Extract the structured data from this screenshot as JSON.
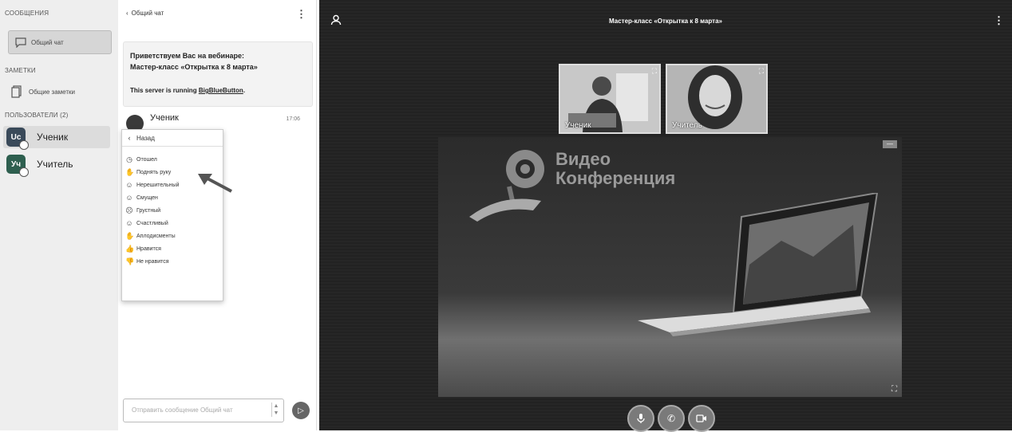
{
  "sidebar": {
    "messages_header": "СООБЩЕНИЯ",
    "chat_item": "Общий чат",
    "notes_header": "ЗАМЕТКИ",
    "notes_item": "Общие заметки",
    "users_header": "ПОЛЬЗОВАТЕЛИ (2)",
    "users": [
      {
        "initials": "Uc",
        "name": "Ученик",
        "color": "#3a4a5a"
      },
      {
        "initials": "Уч",
        "name": "Учитель",
        "color": "#2e5f4f"
      }
    ]
  },
  "chat": {
    "back_label": "Общий чат",
    "welcome_line1": "Приветствуем Вас на вебинаре:",
    "welcome_line2": "Мастер-класс «Открытка к 8 марта»",
    "server_prefix": "This server is running ",
    "server_link": "BigBlueButton",
    "server_suffix": ".",
    "message_author": "Ученик",
    "message_time": "17:06",
    "input_placeholder": "Отправить сообщение Общий чат"
  },
  "status_menu": {
    "back_label": "Назад",
    "items": [
      {
        "icon": "clock-icon",
        "glyph": "◷",
        "label": "Отошел"
      },
      {
        "icon": "hand-icon",
        "glyph": "✋",
        "label": "Поднять руку"
      },
      {
        "icon": "undecided-icon",
        "glyph": "☺",
        "label": "Нерешительный"
      },
      {
        "icon": "confused-icon",
        "glyph": "☺",
        "label": "Смущен"
      },
      {
        "icon": "sad-icon",
        "glyph": "☹",
        "label": "Грустный"
      },
      {
        "icon": "happy-icon",
        "glyph": "☺",
        "label": "Счастливый"
      },
      {
        "icon": "applause-icon",
        "glyph": "✋",
        "label": "Аплодисменты"
      },
      {
        "icon": "thumbs-up-icon",
        "glyph": "👍",
        "label": "Нравится"
      },
      {
        "icon": "thumbs-down-icon",
        "glyph": "👎",
        "label": "Не нравится"
      }
    ]
  },
  "video": {
    "title": "Мастер-класс «Открытка к 8 марта»",
    "thumbnails": [
      {
        "label": "Ученик"
      },
      {
        "label": "Учитель"
      }
    ],
    "presentation_line1": "Видео",
    "presentation_line2": "Конференция"
  }
}
